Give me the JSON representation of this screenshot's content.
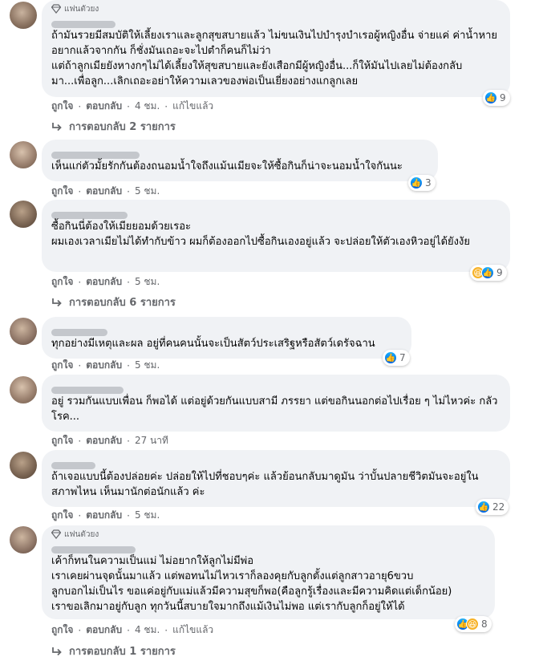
{
  "comments": [
    {
      "badge": "แฟนตัวยง",
      "text": "ถ้ามันรวยมีสมบัติให้เลี้ยงเราและลูกสุขสบายแล้ว ไม่ขนเงินไปบำรุงบำเรอผู้หญิงอื่น จ่ายแค่ ค่าน้ำหายอยากแล้วจากกัน ก็ชั่งมันเถอะจะไปตำก็คนก็ไม่ว่า\nแต่ถ้าลูกเมียยังหางกๆไม่ได้เลี้ยงให้สุขสบายและยังเสือกมีผู้หญิงอื่น...ก็ให้มันไปเลยไม่ต้องกลับมา...เพื่อลูก...เลิกเถอะอย่าให้ความเลวของพ่อเป็นเยี่ยงอย่างแกลูกเลย",
      "like": "ถูกใจ",
      "reply": "ตอบกลับ",
      "time": "4 ชม.",
      "edited": "แก้ไขแล้ว",
      "reaction_count": "9",
      "replies": "การตอบกลับ 2 รายการ"
    },
    {
      "text": "เห็นแก่ตัวมั้ยรักกันต้องถนอมน้ำใจถึงแม้นเมียจะให้ซื้อกินก็น่าจะนอมน้ำใจกันนะ",
      "like": "ถูกใจ",
      "reply": "ตอบกลับ",
      "time": "5 ชม.",
      "reaction_count": "3"
    },
    {
      "text": "ซื้อกินนี่ต้องให้เมียยอมด้วยเรอะ\nผมเองเวลาเมียไม่ได้ทำกับข้าว ผมก็ต้องออกไปซื้อกินเองอยู่แล้ว จะปล่อยให้ตัวเองหิวอยู่ได้ยังงัย",
      "like": "ถูกใจ",
      "reply": "ตอบกลับ",
      "time": "5 ชม.",
      "reaction_count": "9",
      "replies": "การตอบกลับ 6 รายการ"
    },
    {
      "text": "ทุกอย่างมีเหตุและผล อยู่ที่คนคนนั้นจะเป็นสัตว์ประเสริฐหรือสัตว์เดรัจฉาน",
      "like": "ถูกใจ",
      "reply": "ตอบกลับ",
      "time": "5 ชม.",
      "reaction_count": "7"
    },
    {
      "text": "อยู่ รวมกันแบบเพื่อน ก็พอได้ แต่อยู่ด้วยกันแบบสามี ภรรยา แต่ขอกินนอกต่อไปเรื่อย ๆ ไม่ไหวค่ะ กลัวโรค...",
      "like": "ถูกใจ",
      "reply": "ตอบกลับ",
      "time": "27 นาที"
    },
    {
      "text": "ถ้าเจอแบบนี้ต้องปล่อยค่ะ ปล่อยให้ไปที่ชอบๆค่ะ แล้วย้อนกลับมาดูมัน ว่าบั้นปลายชีวิตมันจะอยู่ในสภาพไหน เห็นมานักต่อนักแล้ว ค่ะ",
      "like": "ถูกใจ",
      "reply": "ตอบกลับ",
      "time": "5 ชม.",
      "reaction_count": "22"
    },
    {
      "badge": "แฟนตัวยง",
      "text": "เค้าก็ทนในความเป็นแม่ ไม่อยากให้ลูกไม่มีพ่อ\nเราเคยผ่านจุดนั้นมาแล้ว แต่พอทนไม่ไหวเราก็ลองคุยกับลูกตั้งแต่ลูกสาวอายุ6ขวบ\nลูกบอกไม่เป็นไร ขอแค่อยู่กับแม่แล้วมีความสุขก็พอ(คือลูกรู้เรื่องและมีความคิดแต่เด็กน้อย)\nเราขอเลิกมาอยู่กับลูก ทุกวันนี้สบายใจมากถึงแม้เงินไม่พอ แต่เรากับลูกก็อยู่ให้ได้",
      "like": "ถูกใจ",
      "reply": "ตอบกลับ",
      "time": "4 ชม.",
      "edited": "แก้ไขแล้ว",
      "reaction_count": "8",
      "replies": "การตอบกลับ 1 รายการ"
    }
  ],
  "colors": {
    "bubble": "#f0f2f5",
    "secondary_text": "#65676b",
    "like_blue": "#1877f2"
  },
  "icons": {
    "badge": "diamond-badge-icon",
    "like": "thumbs-up-icon",
    "haha": "haha-emoji-icon",
    "reply_arrow": "reply-arrow-icon"
  }
}
